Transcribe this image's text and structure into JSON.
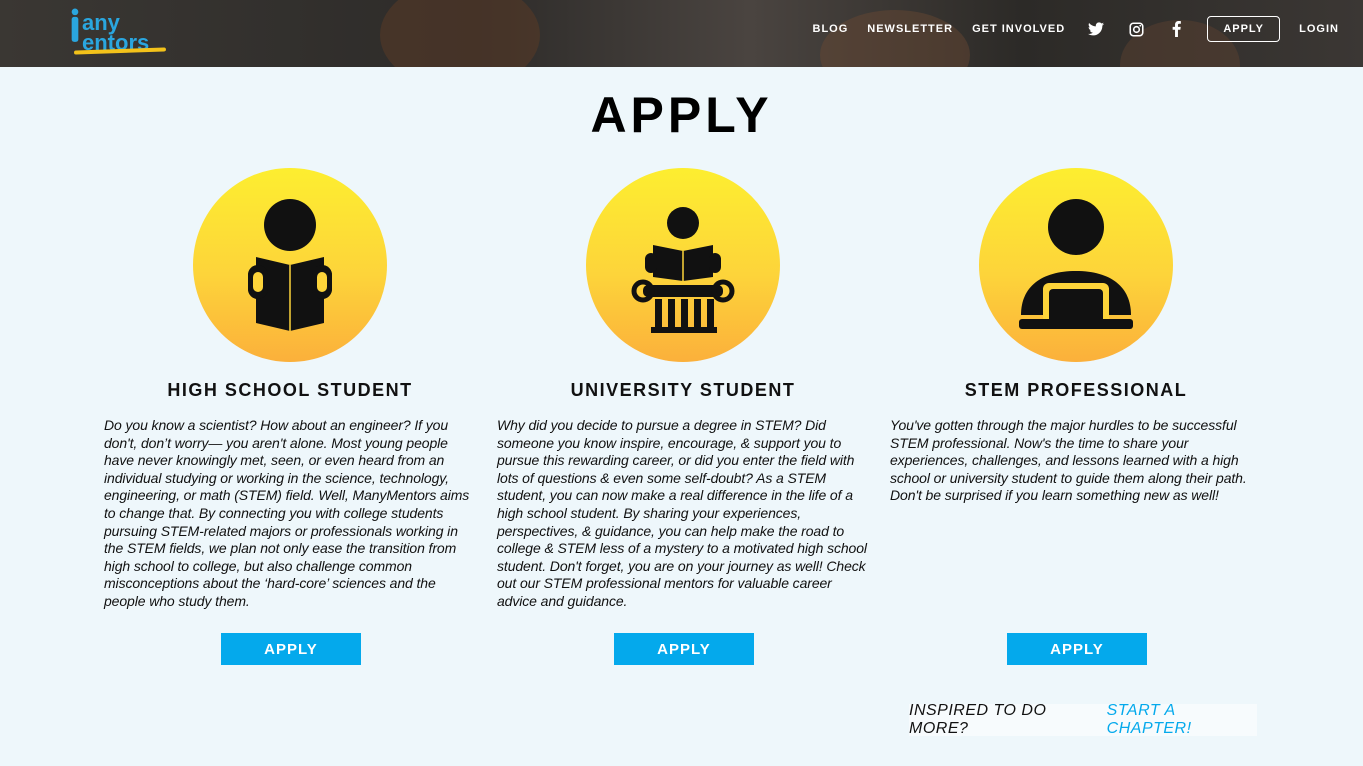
{
  "brand": {
    "line1": "any",
    "line2": "entors",
    "accent": "#2aa6df",
    "underline": "#f3c21a"
  },
  "nav": {
    "links": [
      "BLOG",
      "NEWSLETTER",
      "GET INVOLVED"
    ],
    "icons": [
      "twitter-icon",
      "instagram-icon",
      "facebook-icon"
    ],
    "apply_label": "APPLY",
    "login_label": "LOGIN"
  },
  "page_title": "APPLY",
  "columns": [
    {
      "icon": "student-reading-icon",
      "title": "HIGH SCHOOL STUDENT",
      "body": "Do you know a scientist? How about an engineer? If you don't, don’t worry— you aren't alone. Most young people have never knowingly met, seen, or even heard from an individual studying or working in the science, technology, engineering, or math (STEM) field. Well, ManyMentors aims to change that. By connecting you with college students pursuing STEM-related majors or professionals working in the STEM fields, we plan not only ease the transition from high school to college, but also challenge common misconceptions about the ‘hard-core’ sciences and the people who study them.",
      "button": "APPLY"
    },
    {
      "icon": "university-student-icon",
      "title": "UNIVERSITY STUDENT",
      "body": "Why did you decide to pursue a degree in STEM? Did someone you know inspire, encourage, & support you to pursue this rewarding career, or did you enter the field with lots of questions & even some self-doubt? As a STEM student, you can now make a real difference in the life of a high school student. By sharing your experiences, perspectives, & guidance, you can help make the road to college & STEM less of a mystery to a motivated high school student. Don't forget, you are on your journey as well! Check out our STEM professional mentors for valuable career advice and guidance.",
      "button": "APPLY"
    },
    {
      "icon": "professional-laptop-icon",
      "title": "STEM PROFESSIONAL",
      "body": "You've gotten through the major hurdles to be successful STEM professional. Now's the time to share your experiences, challenges, and lessons learned with a high school or university student to guide them along their path. Don't be surprised if you learn something new as well!",
      "button": "APPLY"
    }
  ],
  "chapter": {
    "question": "INSPIRED TO DO MORE?",
    "link": "START A CHAPTER!"
  },
  "colors": {
    "button_blue": "#04a9ec",
    "circle_top": "#fdee30",
    "circle_bottom": "#fbb03b"
  }
}
